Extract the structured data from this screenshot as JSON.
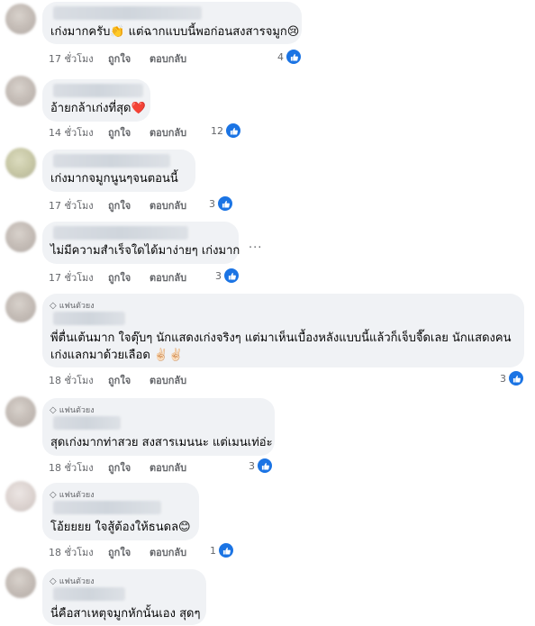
{
  "comments": [
    {
      "text": "เก่งมากครับ👏 แต่ฉากแบบนี้พอก่อนสงสารจมูก😢",
      "time": "17 ชั่วโมง",
      "like": "ถูกใจ",
      "reply": "ตอบกลับ",
      "reactions": "4",
      "badge": ""
    },
    {
      "text": "อ้ายกล้าเก่งที่สุด❤️",
      "time": "14 ชั่วโมง",
      "like": "ถูกใจ",
      "reply": "ตอบกลับ",
      "reactions": "12",
      "badge": ""
    },
    {
      "text": "เก่งมากจมูกนูนๆจนตอนนี้",
      "time": "17 ชั่วโมง",
      "like": "ถูกใจ",
      "reply": "ตอบกลับ",
      "reactions": "3",
      "badge": ""
    },
    {
      "text": "ไม่มีความสำเร็จใดได้มาง่ายๆ เก่งมาก",
      "time": "17 ชั่วโมง",
      "like": "ถูกใจ",
      "reply": "ตอบกลับ",
      "reactions": "3",
      "badge": ""
    },
    {
      "text": "พี่ตื่นเต้นมาก ใจตุ๊บๆ นักแสดงเก่งจริงๆ แต่มาเห็นเบื้องหลังแบบนี้แล้วก็เจ็บจี๊ดเลย นักแสดงคน",
      "text2": "เก่งแลกมาด้วยเลือด ✌🏻✌🏻",
      "time": "18 ชั่วโมง",
      "like": "ถูกใจ",
      "reply": "ตอบกลับ",
      "reactions": "3",
      "badge": "แฟนตัวยง"
    },
    {
      "text": "สุดเก่งมากท่าสวย สงสารเมนนะ แต่เมนเท่อ่ะ",
      "time": "18 ชั่วโมง",
      "like": "ถูกใจ",
      "reply": "ตอบกลับ",
      "reactions": "3",
      "badge": "แฟนตัวยง"
    },
    {
      "text": "โอ้ยยยย ใจสู้ต้องให้ธนดล😊",
      "time": "18 ชั่วโมง",
      "like": "ถูกใจ",
      "reply": "ตอบกลับ",
      "reactions": "1",
      "badge": "แฟนตัวยง"
    },
    {
      "text": "นี่คือสาเหตุจมูกหักนั้นเอง สุดๆ",
      "badge": "แฟนตัวยง"
    }
  ],
  "more_options": "···",
  "colors": {
    "like_blue": "#1b74e4",
    "bubble": "#f0f2f5",
    "meta": "#65676b"
  }
}
